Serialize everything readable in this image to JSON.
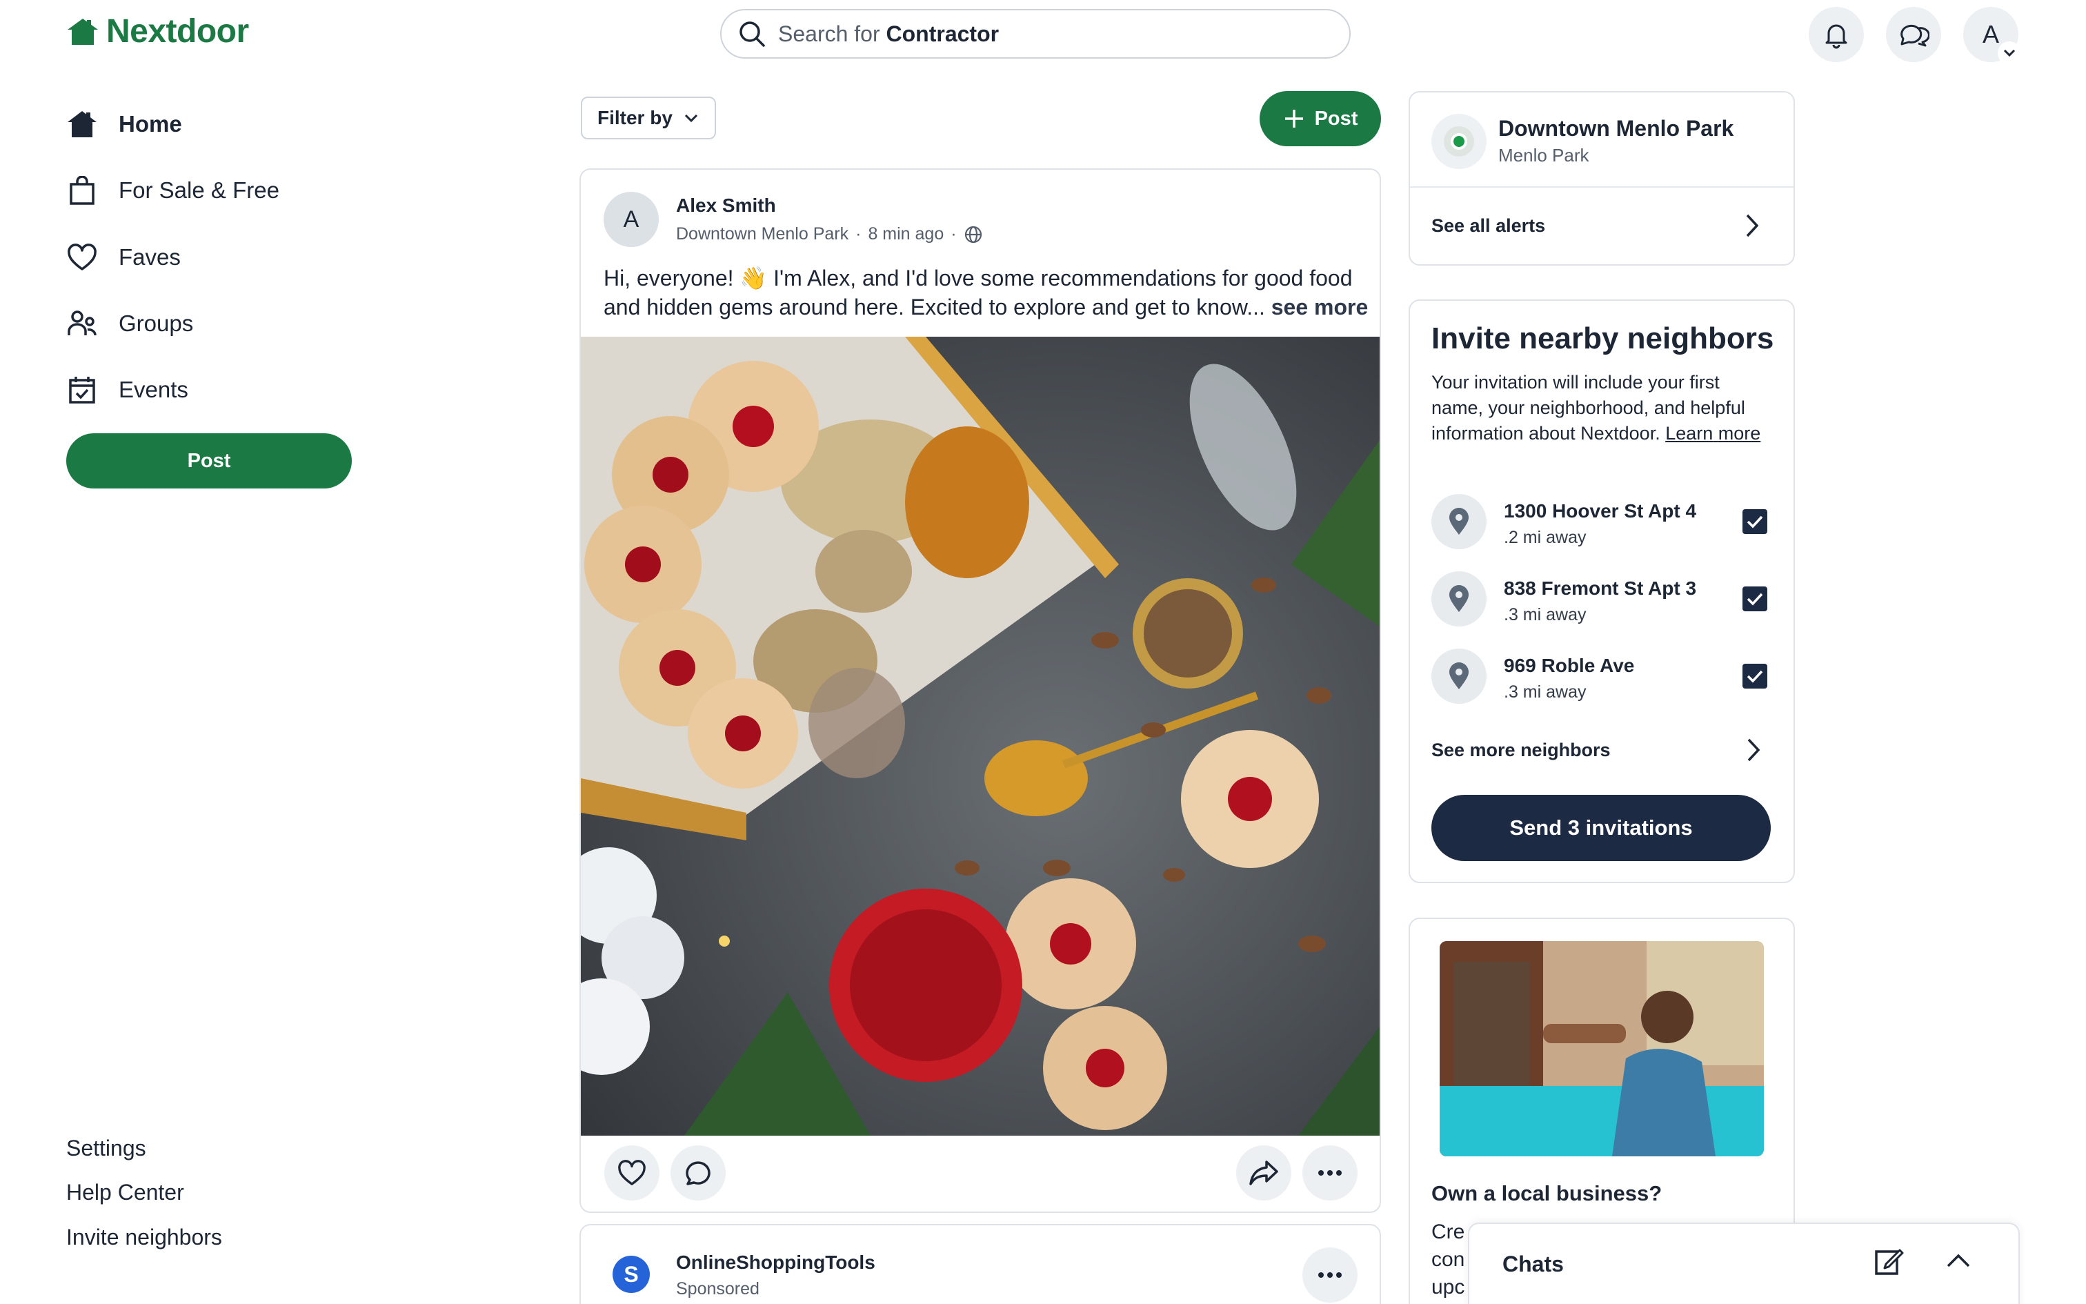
{
  "app": {
    "name": "Nextdoor",
    "brand_color": "#1b7a43",
    "dark_color": "#1d2a44"
  },
  "search": {
    "prefix": "Search for ",
    "keyword": "Contractor"
  },
  "header": {
    "profile_initial": "A"
  },
  "sidebar": {
    "items": [
      {
        "label": "Home",
        "icon": "home-icon",
        "active": true
      },
      {
        "label": "For Sale & Free",
        "icon": "shopping-bag-icon"
      },
      {
        "label": "Faves",
        "icon": "heart-icon"
      },
      {
        "label": "Groups",
        "icon": "groups-icon"
      },
      {
        "label": "Events",
        "icon": "calendar-icon"
      }
    ],
    "post_label": "Post",
    "footer_links": [
      "Settings",
      "Help Center",
      "Invite neighbors"
    ]
  },
  "feed": {
    "filter_label": "Filter by",
    "post_button_label": "Post",
    "post": {
      "author_initial": "A",
      "author": "Alex Smith",
      "neighborhood": "Downtown Menlo Park",
      "time": "8 min ago",
      "text_line1": "Hi, everyone! 👋 I'm Alex, and I'd love some recommendations for good food",
      "text_line2": "and hidden gems around here. Excited to explore and get to know...",
      "see_more": "see more",
      "image_desc": "holiday-cookies-photo"
    },
    "sponsored": {
      "name": "OnlineShoppingTools",
      "label": "Sponsored"
    }
  },
  "right": {
    "alerts": {
      "title": "Downtown Menlo Park",
      "subtitle": "Menlo Park",
      "see_all": "See all alerts"
    },
    "invite": {
      "title": "Invite nearby neighbors",
      "body": "Your invitation will include your first name, your neighborhood, and helpful information about Nextdoor.",
      "learn": "Learn",
      "more": "more",
      "neighbors": [
        {
          "address": "1300 Hoover St Apt 4",
          "distance": ".2 mi away",
          "checked": true
        },
        {
          "address": "838 Fremont St Apt 3",
          "distance": ".3 mi away",
          "checked": true
        },
        {
          "address": "969 Roble Ave",
          "distance": ".3 mi away",
          "checked": true
        }
      ],
      "see_more": "See more neighbors",
      "send_label": "Send 3 invitations"
    },
    "business": {
      "title": "Own a local business?",
      "text_frag1": "Cre",
      "text_frag2": "con",
      "text_frag3": "upc"
    }
  },
  "chats": {
    "label": "Chats"
  }
}
